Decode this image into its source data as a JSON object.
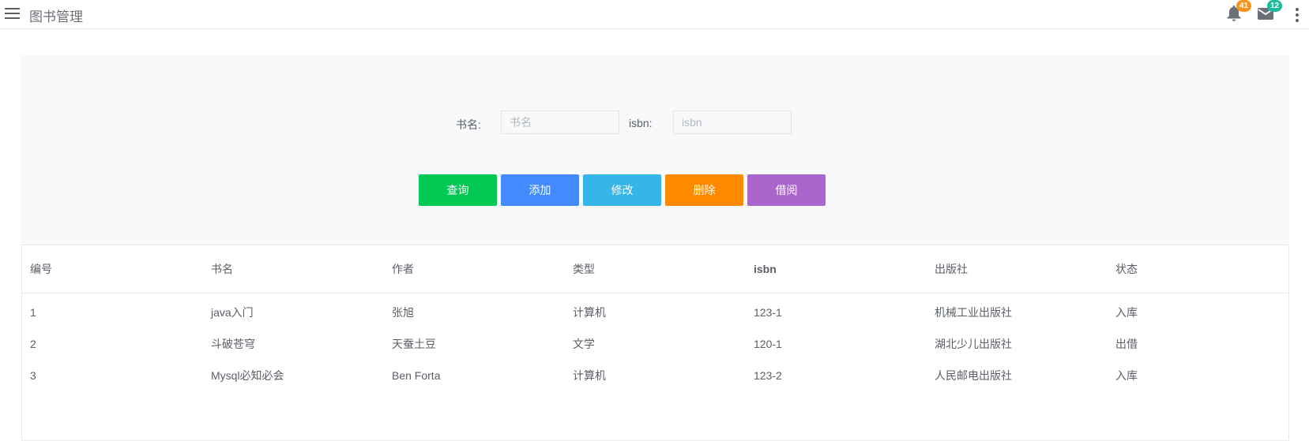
{
  "header": {
    "title": "图书管理",
    "notifications_count": "41",
    "messages_count": "12",
    "menu_icon": "hamburger-icon",
    "more_icon": "more-vertical-icon"
  },
  "search": {
    "name_label": "书名:",
    "name_placeholder": "书名",
    "name_value": "",
    "isbn_label": "isbn:",
    "isbn_placeholder": "isbn",
    "isbn_value": ""
  },
  "buttons": {
    "query": {
      "label": "查询",
      "color": "#00c853"
    },
    "add": {
      "label": "添加",
      "color": "#448aff"
    },
    "edit": {
      "label": "修改",
      "color": "#36b6e8"
    },
    "delete": {
      "label": "删除",
      "color": "#ff8a00"
    },
    "borrow": {
      "label": "借阅",
      "color": "#aa66cc"
    }
  },
  "table": {
    "columns": [
      "编号",
      "书名",
      "作者",
      "类型",
      "isbn",
      "出版社",
      "状态"
    ],
    "rows": [
      [
        "1",
        "java入门",
        "张旭",
        "计算机",
        "123-1",
        "机械工业出版社",
        "入库"
      ],
      [
        "2",
        "斗破苍穹",
        "天蚕土豆",
        "文学",
        "120-1",
        "湖北少儿出版社",
        "出借"
      ],
      [
        "3",
        "Mysql必知必会",
        "Ben Forta",
        "计算机",
        "123-2",
        "人民邮电出版社",
        "入库"
      ]
    ]
  }
}
